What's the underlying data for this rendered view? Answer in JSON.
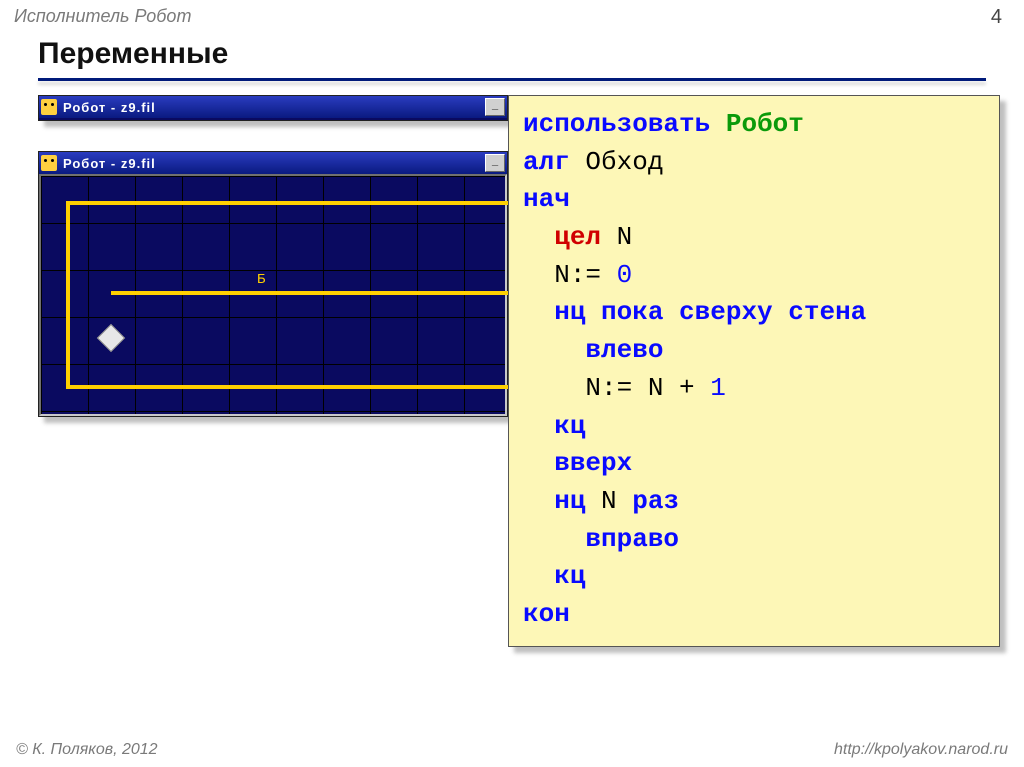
{
  "header": {
    "subject": "Исполнитель Робот",
    "page_number": "4"
  },
  "title": "Переменные",
  "windows": {
    "title": "Робот - z9.fil",
    "min_label": "_",
    "cell_label": "Б"
  },
  "code": {
    "use": "использовать",
    "robot": "Робот",
    "alg": "алг",
    "alg_name": "Обход",
    "begin": "нач",
    "type_int": "цел",
    "var": "N",
    "assign": "N:= ",
    "zero": "0",
    "loop_while": "нц пока",
    "cond": "сверху стена",
    "cmd_left": "влево",
    "inc": "N:= N + ",
    "one": "1",
    "loop_end": "кц",
    "cmd_up": "вверх",
    "loop_n": "нц",
    "loop_n_tail": " N ",
    "times": "раз",
    "cmd_right": "вправо",
    "end": "кон"
  },
  "footer": {
    "copyright": "© К. Поляков, 2012",
    "url": "http://kpolyakov.narod.ru"
  }
}
